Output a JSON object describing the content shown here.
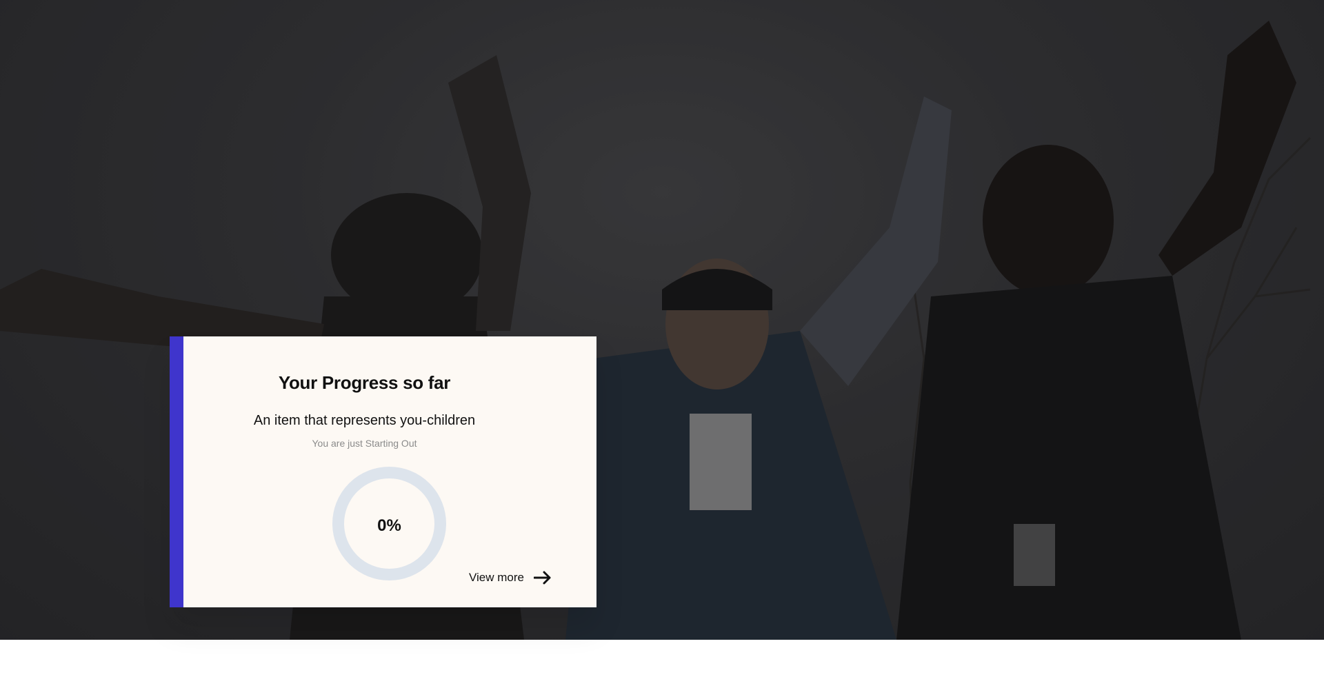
{
  "progress_card": {
    "title": "Your Progress so far",
    "item": "An item that represents you-children",
    "status": "You are just Starting Out",
    "percent": 0,
    "percent_label": "0%",
    "view_more_label": "View more",
    "arrow_icon": "arrow-right-icon"
  },
  "colors": {
    "accent": "#3f35cc",
    "card_bg": "#fdf9f4",
    "ring_track": "#dde4ec",
    "ring_fill": "#3f35cc"
  }
}
